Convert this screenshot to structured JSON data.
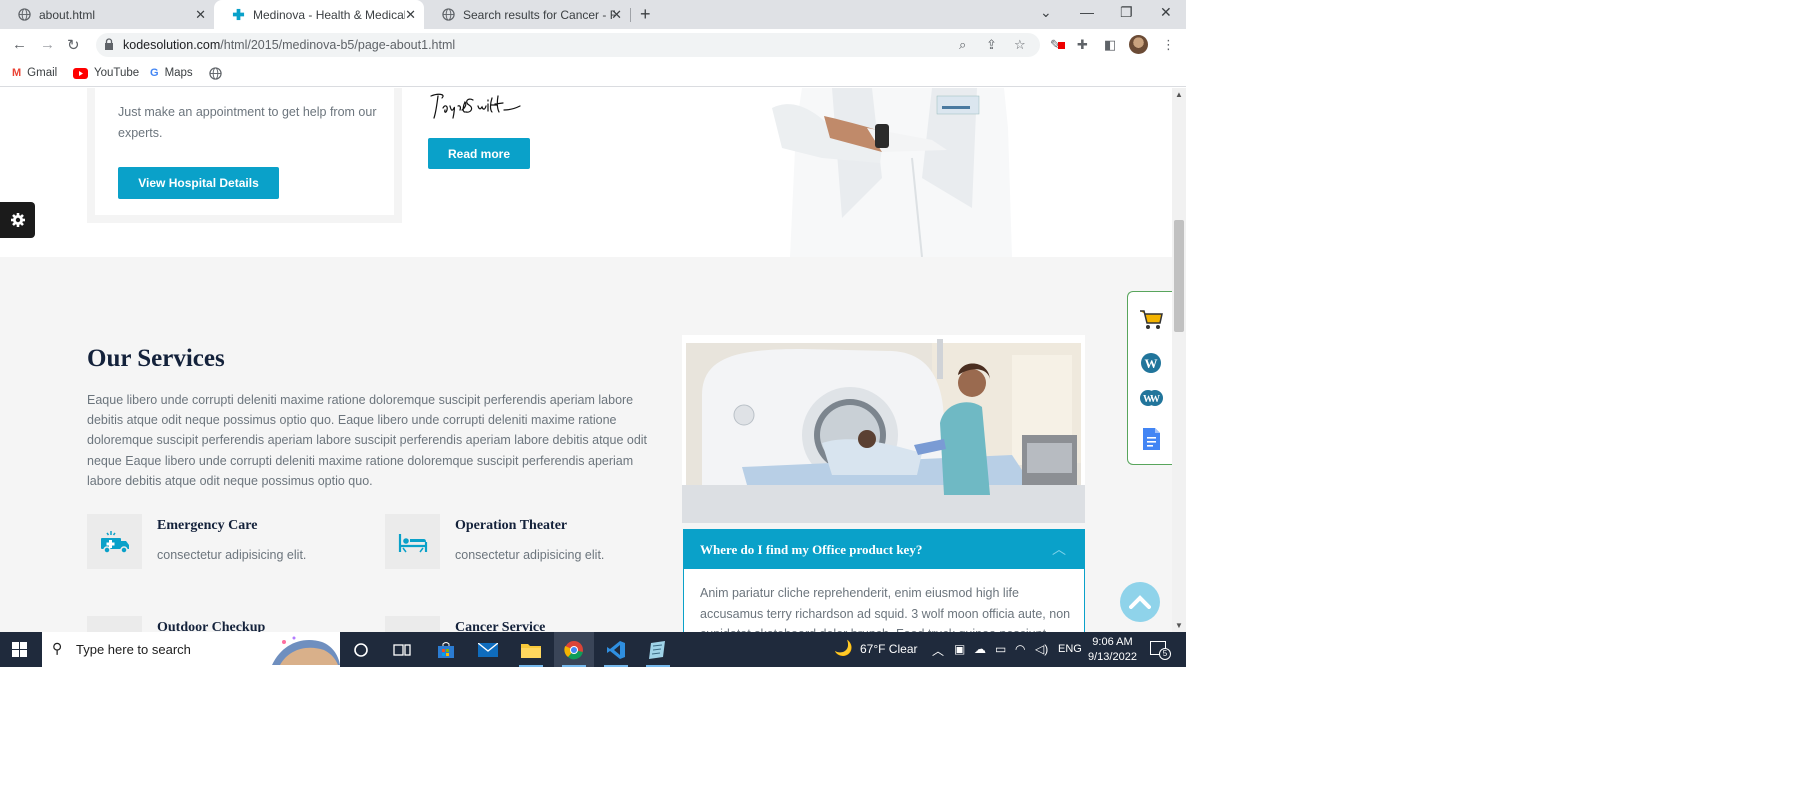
{
  "browser": {
    "tabs": [
      {
        "label": "about.html",
        "active": false
      },
      {
        "label": "Medinova - Health & Medical HT",
        "active": true
      },
      {
        "label": "Search results for Cancer - Flatic",
        "active": false
      }
    ],
    "url_host": "kodesolution.com",
    "url_path": "/html/2015/medinova-b5/page-about1.html",
    "bookmarks": [
      {
        "label": "Gmail"
      },
      {
        "label": "YouTube"
      },
      {
        "label": "Maps"
      }
    ]
  },
  "page": {
    "hospital_card": {
      "text": "Just make an appointment to get help from our experts.",
      "button": "View Hospital Details"
    },
    "read_more": "Read more",
    "services": {
      "heading": "Our Services",
      "description": "Eaque libero unde corrupti deleniti maxime ratione doloremque suscipit perferendis aperiam labore debitis atque odit neque possimus optio quo. Eaque libero unde corrupti deleniti maxime ratione doloremque suscipit perferendis aperiam labore suscipit perferendis aperiam labore debitis atque odit neque Eaque libero unde corrupti deleniti maxime ratione doloremque suscipit perferendis aperiam labore debitis atque odit neque possimus optio quo.",
      "items": [
        {
          "title": "Emergency Care",
          "subtitle": "consectetur adipisicing elit.",
          "icon": "ambulance-icon"
        },
        {
          "title": "Operation Theater",
          "subtitle": "consectetur adipisicing elit.",
          "icon": "hospital-bed-icon"
        },
        {
          "title": "Outdoor Checkup",
          "subtitle": "",
          "icon": "checkup-icon"
        },
        {
          "title": "Cancer Service",
          "subtitle": "",
          "icon": "cancer-ribbon-icon"
        }
      ]
    },
    "faq": {
      "question": "Where do I find my Office product key?",
      "answer": "Anim pariatur cliche reprehenderit, enim eiusmod high life accusamus terry richardson ad squid. 3 wolf moon officia aute, non cupidatat skateboard dolor brunch. Food truck quinoa nesciunt laborum"
    }
  },
  "taskbar": {
    "search_placeholder": "Type here to search",
    "weather": "67°F  Clear",
    "language": "ENG",
    "time": "9:06 AM",
    "date": "9/13/2022",
    "notifications": "5"
  },
  "colors": {
    "accent": "#0aa1c9",
    "heading": "#14223b",
    "text": "#6c757d",
    "services_bg": "#f5f5f5",
    "taskbar": "#1f2a3c"
  }
}
